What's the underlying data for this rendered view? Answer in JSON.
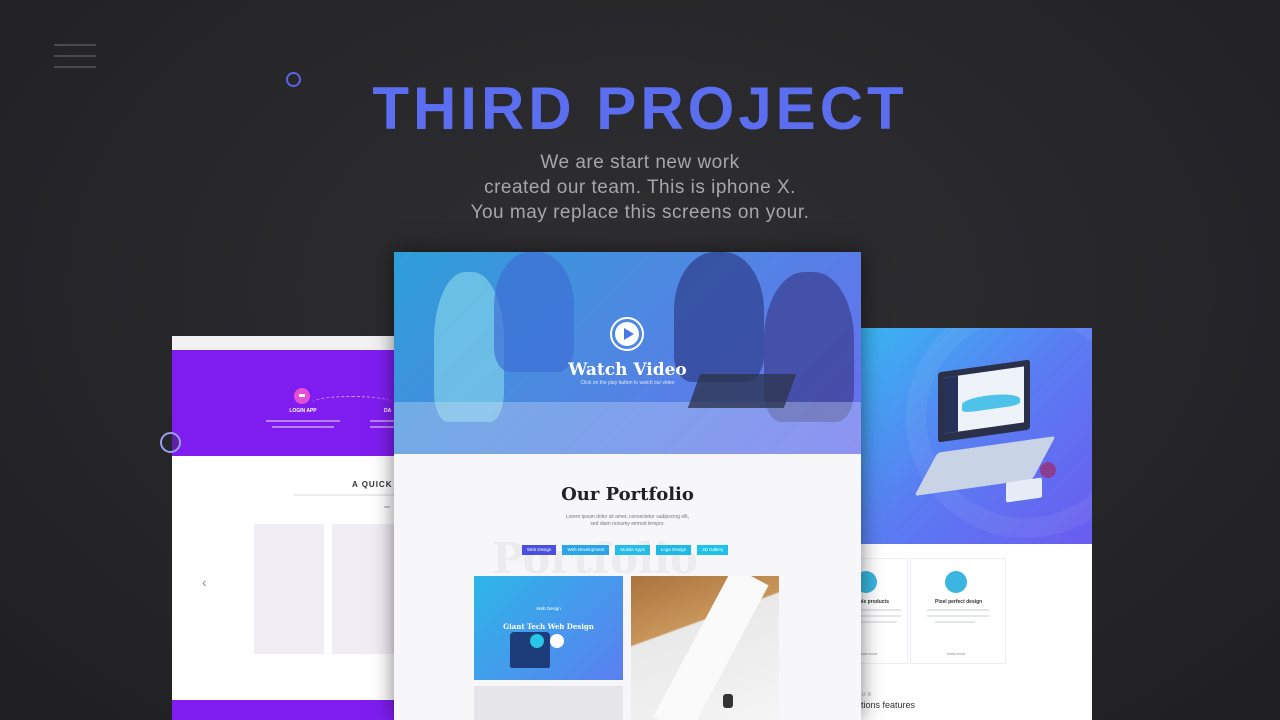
{
  "hero_text": {
    "title": "THIRD PROJECT",
    "subtitle_lines": [
      "We are start new work",
      "created our team. This is iphone X.",
      "You may replace this screens on your."
    ]
  },
  "left_mockup": {
    "step_label": "LOGIN APP",
    "step_label_2": "DA",
    "section_title": "A QUICK V",
    "arrow": "‹"
  },
  "center_mockup": {
    "video_title": "Watch Video",
    "video_subtitle": "Click on the play button to watch our video",
    "portfolio_title": "Our Portfolio",
    "portfolio_ghost": "Portfolio",
    "portfolio_desc_lines": [
      "Lorem ipsum dolor sit amet, consectetur sadipscing elit,",
      "sed diam nonumy eirmod tempor."
    ],
    "filters": [
      {
        "label": "Web Design",
        "color": "#4a4fe0"
      },
      {
        "label": "Web Development",
        "color": "#2aa6e8"
      },
      {
        "label": "Mobile Apps",
        "color": "#23bde8"
      },
      {
        "label": "Logo Design",
        "color": "#1fb9e6"
      },
      {
        "label": "3D Gallery",
        "color": "#1ec3ea"
      }
    ],
    "card": {
      "category": "Web Design",
      "name": "Giant Tech Web Design"
    }
  },
  "right_mockup": {
    "feature_1_title": "ple products",
    "feature_2_title": "Pixel perfect design",
    "read_more": "read more",
    "section_sup": "OUR",
    "section_title": "ations features"
  },
  "colors": {
    "accent": "#5b6ef0",
    "purple": "#7f1df0",
    "background": "#2b2b2e"
  }
}
